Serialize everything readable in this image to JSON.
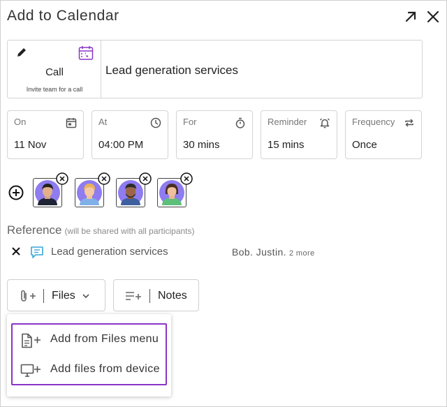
{
  "header": {
    "title": "Add to Calendar"
  },
  "activity": {
    "type_label": "Call",
    "type_sub": "Invite team for a call",
    "subject": "Lead generation services"
  },
  "fields": [
    {
      "label": "On",
      "value": "11 Nov",
      "icon": "calendar-icon"
    },
    {
      "label": "At",
      "value": "04:00 PM",
      "icon": "clock-icon"
    },
    {
      "label": "For",
      "value": "30 mins",
      "icon": "stopwatch-icon"
    },
    {
      "label": "Reminder",
      "value": "15 mins",
      "icon": "bell-icon"
    },
    {
      "label": "Frequency",
      "value": "Once",
      "icon": "repeat-icon"
    }
  ],
  "participants": {
    "count": 4
  },
  "reference": {
    "title": "Reference",
    "note": "(will be shared with all participants)",
    "item_name": "Lead generation services",
    "people": "Bob. Justin.",
    "more": "2 more"
  },
  "attachments": {
    "files_label": "Files",
    "notes_label": "Notes"
  },
  "files_menu": {
    "items": [
      {
        "label": "Add from Files menu",
        "icon": "file-plus-icon"
      },
      {
        "label": "Add files from device",
        "icon": "monitor-plus-icon"
      }
    ]
  },
  "colors": {
    "accent_purple": "#8a35c7",
    "chat_icon": "#3aa7d9",
    "avatar_bg": "#8e7cf0"
  }
}
